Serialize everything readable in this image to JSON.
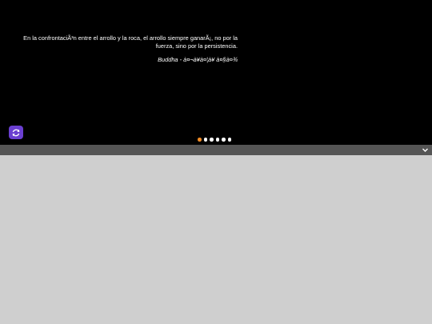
{
  "hero": {
    "quote_text": "En la confrontaciÃ³n entre el arrollo y la roca, el arrollo siempre ganarÃ¡, no por la fuerza, sino por la persistencia.",
    "quote_author": "Buddha - à¤¬à¥à¤¦à¥  à¤§à¤¾",
    "refresh_icon": "refresh-icon",
    "carousel": {
      "total": 6,
      "active_index": 0
    }
  },
  "toggle_bar": {
    "icon": "chevron-down-icon"
  },
  "colors": {
    "hero_bg": "#000000",
    "accent_purple": "#6a3fd0",
    "active_dot": "#f08a24",
    "bar_bg": "#555555",
    "content_bg": "#cfcfcf"
  }
}
